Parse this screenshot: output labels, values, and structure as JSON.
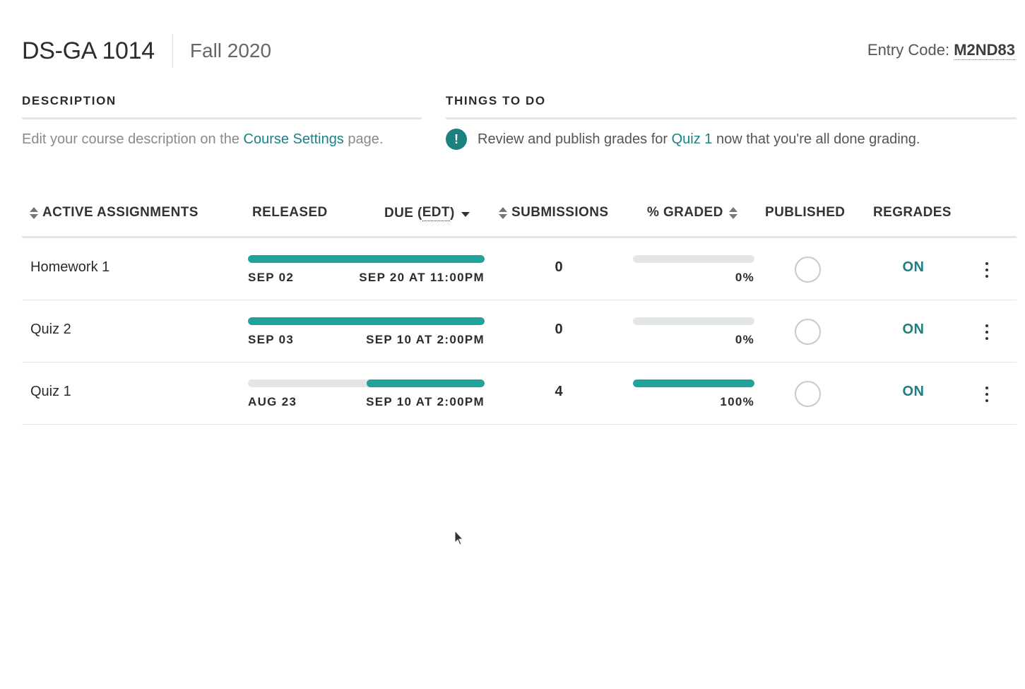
{
  "header": {
    "course_code": "DS-GA 1014",
    "term": "Fall 2020",
    "entry_label": "Entry Code:",
    "entry_code": "M2ND83"
  },
  "description": {
    "title": "DESCRIPTION",
    "text_before": "Edit your course description on the ",
    "link": "Course Settings",
    "text_after": " page."
  },
  "todo": {
    "title": "THINGS TO DO",
    "icon": "exclamation-icon",
    "text_before": "Review and publish grades for ",
    "link": "Quiz 1",
    "text_after": " now that you're all done grading."
  },
  "table": {
    "columns": {
      "assignments": "ACTIVE ASSIGNMENTS",
      "released": "RELEASED",
      "due_prefix": "DUE (",
      "due_tz": "EDT",
      "due_suffix": ")",
      "submissions": "SUBMISSIONS",
      "graded": "% GRADED",
      "published": "PUBLISHED",
      "regrades": "REGRADES"
    },
    "rows": [
      {
        "name": "Homework 1",
        "released": "SEP 02",
        "due": "SEP 20 AT 11:00PM",
        "elapsed_start": 0.0,
        "elapsed_end": 1.0,
        "submissions": "0",
        "graded_pct": "0%",
        "graded_fraction": 0.0,
        "regrades": "ON"
      },
      {
        "name": "Quiz 2",
        "released": "SEP 03",
        "due": "SEP 10 AT 2:00PM",
        "elapsed_start": 0.0,
        "elapsed_end": 1.0,
        "submissions": "0",
        "graded_pct": "0%",
        "graded_fraction": 0.0,
        "regrades": "ON"
      },
      {
        "name": "Quiz 1",
        "released": "AUG 23",
        "due": "SEP 10 AT 2:00PM",
        "elapsed_start": 0.5,
        "elapsed_end": 1.0,
        "submissions": "4",
        "graded_pct": "100%",
        "graded_fraction": 1.0,
        "regrades": "ON"
      }
    ]
  },
  "colors": {
    "accent": "#1e7f80",
    "bar": "#1fa39a",
    "track": "#e3e6e6"
  }
}
